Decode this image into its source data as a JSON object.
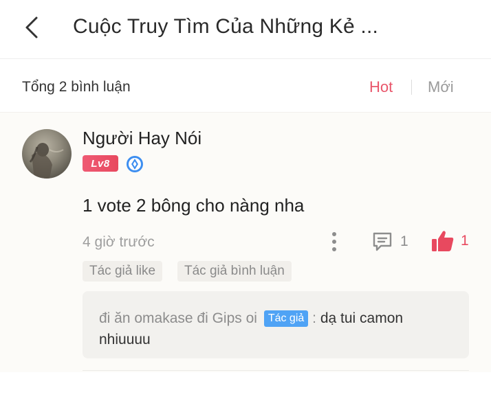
{
  "header": {
    "title": "Cuộc Truy Tìm Của Những Kẻ ..."
  },
  "summary": {
    "total": "Tổng 2 bình luận",
    "sort_hot": "Hot",
    "sort_new": "Mới"
  },
  "comment": {
    "username": "Người Hay Nói",
    "level": "Lv8",
    "content": "1 vote 2 bông cho nàng nha",
    "time": "4 giờ trước",
    "reply_count": "1",
    "like_count": "1",
    "tags": [
      "Tác giả like",
      "Tác giả bình luận"
    ],
    "reply": {
      "name": "đi ăn omakase đi Gips oi",
      "author_tag": "Tác giả",
      "separator": ":",
      "text": "dạ tui camon nhiuuuu"
    }
  },
  "colors": {
    "accent": "#e9566b",
    "author_tag": "#4fa3f5"
  },
  "icons": {
    "back": "chevron-left-icon",
    "verify": "verified-badge-icon",
    "more": "more-vertical-icon",
    "reply": "comment-icon",
    "like": "thumbs-up-icon"
  }
}
